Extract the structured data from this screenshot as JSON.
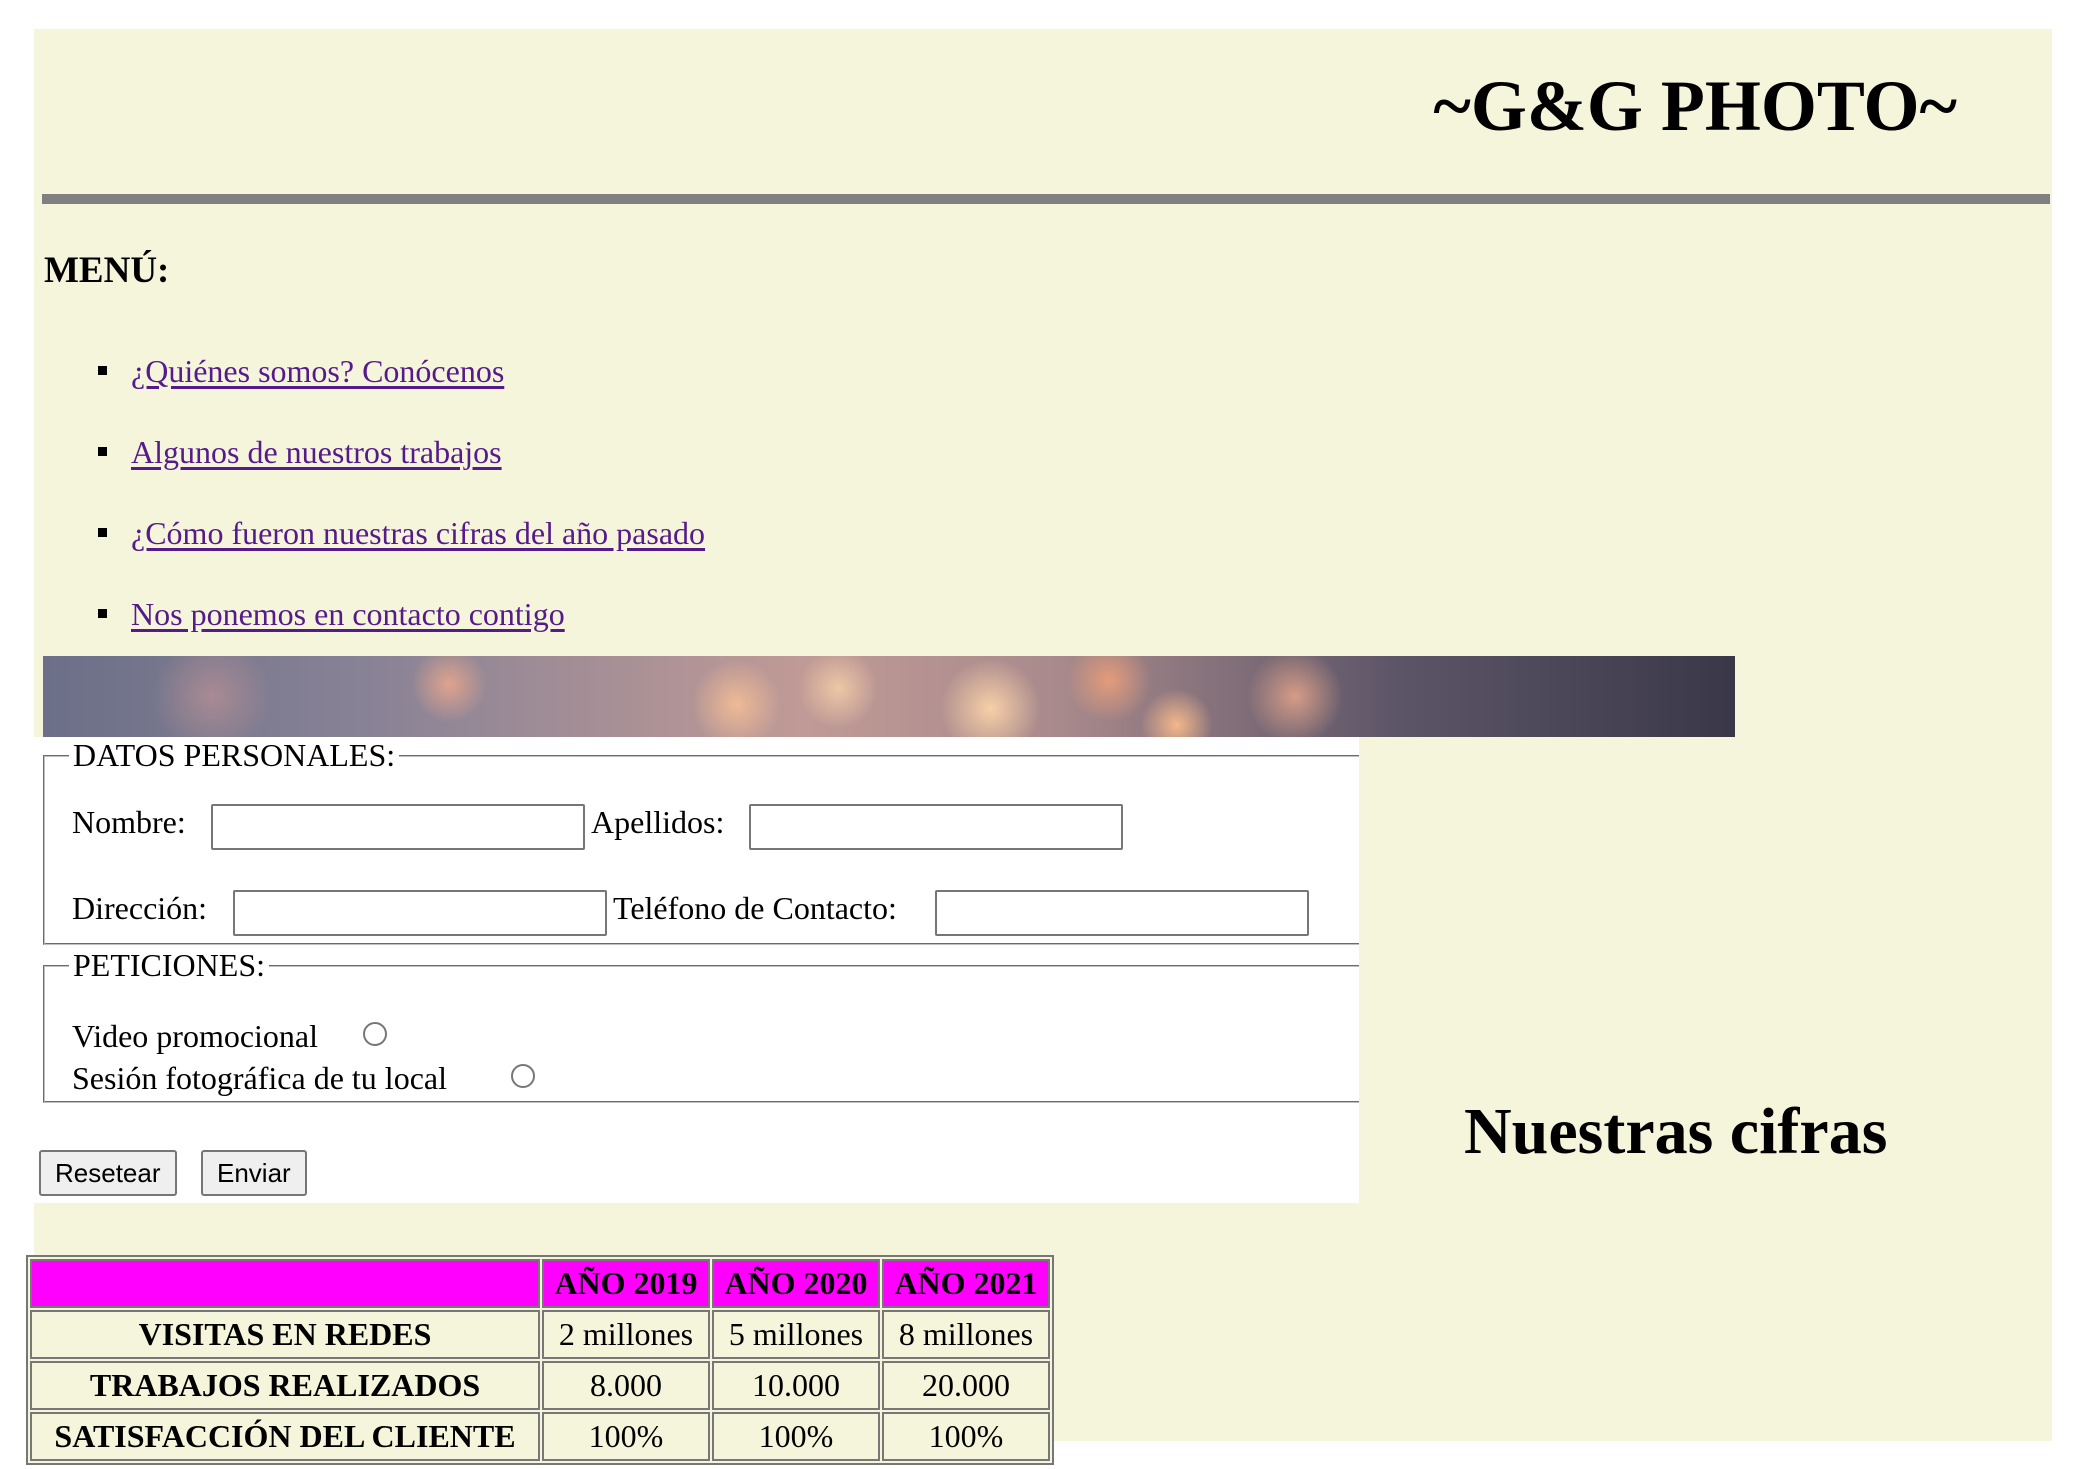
{
  "header": {
    "site_title": "~G&G PHOTO~"
  },
  "menu": {
    "heading": "MENÚ:",
    "items": [
      {
        "label": "¿Quiénes somos? Conócenos"
      },
      {
        "label": "Algunos de nuestros trabajos"
      },
      {
        "label": "¿Cómo fueron nuestras cifras del año pasado"
      },
      {
        "label": "Nos ponemos en contacto contigo"
      }
    ]
  },
  "form": {
    "personal_legend": "DATOS PERSONALES:",
    "fields": {
      "nombre_label": "Nombre:",
      "apellidos_label": "Apellidos:",
      "direccion_label": "Dirección:",
      "telefono_label": "Teléfono de Contacto:",
      "nombre_value": "",
      "apellidos_value": "",
      "direccion_value": "",
      "telefono_value": ""
    },
    "requests_legend": "PETICIONES:",
    "options": [
      {
        "label": "Video promocional",
        "checked": false
      },
      {
        "label": "Sesión fotográfica de tu local",
        "checked": false
      }
    ],
    "reset_label": "Resetear",
    "submit_label": "Enviar"
  },
  "figures": {
    "heading": "Nuestras cifras",
    "header_color": "#ff00ff",
    "columns": [
      "",
      "AÑO 2019",
      "AÑO 2020",
      "AÑO 2021"
    ],
    "rows": [
      {
        "label": "VISITAS EN REDES",
        "values": [
          "2 millones",
          "5 millones",
          "8 millones"
        ]
      },
      {
        "label": "TRABAJOS REALIZADOS",
        "values": [
          "8.000",
          "10.000",
          "20.000"
        ]
      },
      {
        "label": "SATISFACCIÓN DEL CLIENTE",
        "values": [
          "100%",
          "100%",
          "100%"
        ]
      }
    ]
  },
  "colors": {
    "page_background": "#f5f5dc",
    "link": "#551a8b",
    "rule": "#808080"
  }
}
